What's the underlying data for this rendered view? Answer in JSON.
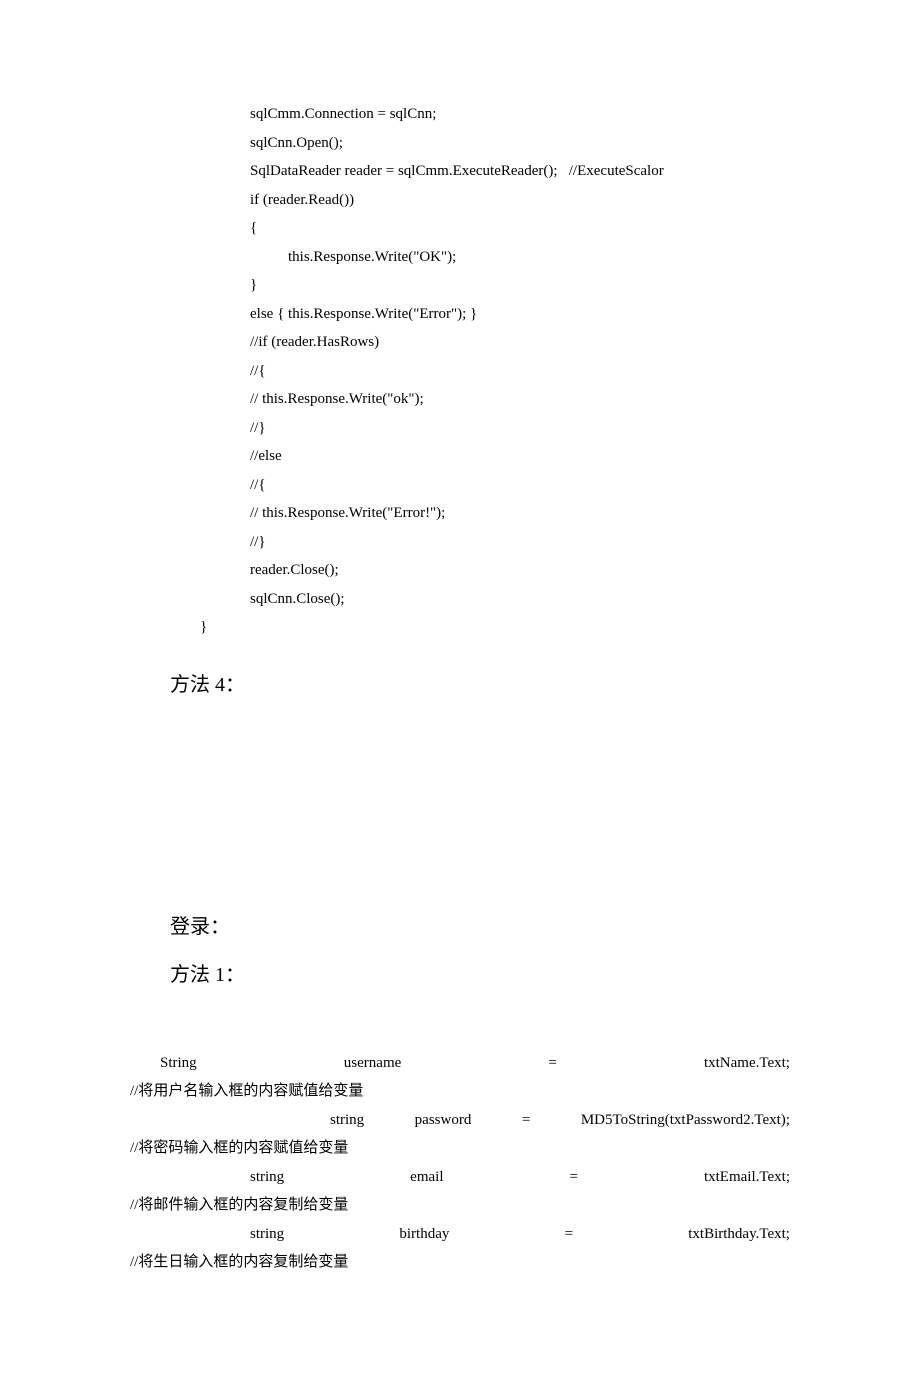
{
  "code": {
    "l1": "sqlCmm.Connection = sqlCnn;",
    "l2": "sqlCnn.Open();",
    "l3_a": "SqlDataReader reader = sqlCmm.ExecuteReader();",
    "l3_b": "//ExecuteScalor",
    "l4": "if (reader.Read())",
    "l5": "{",
    "l6": "this.Response.Write(\"OK\");",
    "l7": "}",
    "l8": "else { this.Response.Write(\"Error\"); }",
    "l9": "//if (reader.HasRows)",
    "l10": "//{",
    "l11": "//       this.Response.Write(\"ok\");",
    "l12": "//}",
    "l13": "//else",
    "l14": "//{",
    "l15": "//       this.Response.Write(\"Error!\");",
    "l16": "//}",
    "l17": "reader.Close();",
    "l18": "sqlCnn.Close();",
    "l19": "}"
  },
  "heading1": "方法 4：",
  "heading2": "登录：",
  "heading3": "方法 1：",
  "block2": {
    "l1": {
      "a": "String",
      "b": "username",
      "c": "=",
      "d": "txtName.Text;"
    },
    "c1": "//将用户名输入框的内容赋值给变量",
    "l2": {
      "a": "string",
      "b": "password",
      "c": "=",
      "d": "MD5ToString(txtPassword2.Text);"
    },
    "c2": "//将密码输入框的内容赋值给变量",
    "l3": {
      "a": "string",
      "b": "email",
      "c": "=",
      "d": "txtEmail.Text;"
    },
    "c3": "//将邮件输入框的内容复制给变量",
    "l4": {
      "a": "string",
      "b": "birthday",
      "c": "=",
      "d": "txtBirthday.Text;"
    },
    "c4": "//将生日输入框的内容复制给变量"
  }
}
